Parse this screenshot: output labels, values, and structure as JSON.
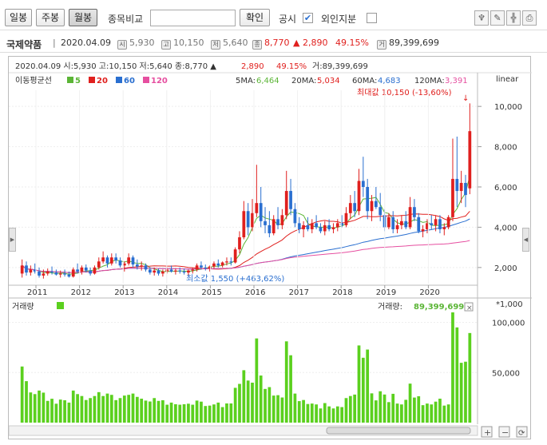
{
  "toolbar": {
    "daily": "일봉",
    "weekly": "주봉",
    "monthly": "월봉",
    "compare_label": "종목비교",
    "confirm": "확인",
    "disclosure": "공시",
    "foreign": "외인지분",
    "disclosure_checked": "✔"
  },
  "info": {
    "name": "국제약품",
    "date": "2020.04.09",
    "open": "5,930",
    "high": "10,150",
    "low": "5,640",
    "close": "8,770",
    "change": "▲ 2,890",
    "pct": "49.15%",
    "volume": "89,399,699",
    "icon_open": "시",
    "icon_high": "고",
    "icon_low": "저",
    "icon_close": "종",
    "icon_vol": "거"
  },
  "chart": {
    "ohlc_line": "2020.04.09  시:5,930  고:10,150  저:5,640  종:8,770  ▲",
    "ohlc_change": "2,890",
    "ohlc_pct": "49.15%",
    "ohlc_vol": "거:89,399,699",
    "ma_label": "이동평균선",
    "ma_legend": [
      {
        "label": "5",
        "color": "#5bb536"
      },
      {
        "label": "20",
        "color": "#e0201e"
      },
      {
        "label": "60",
        "color": "#2a6fd0"
      },
      {
        "label": "120",
        "color": "#e64fa0"
      }
    ],
    "ma_values": [
      {
        "label": "5MA:",
        "value": "6,464",
        "color": "#5bb536"
      },
      {
        "label": "20MA:",
        "value": "5,034",
        "color": "#e0201e"
      },
      {
        "label": "60MA:",
        "value": "4,683",
        "color": "#2a6fd0"
      },
      {
        "label": "120MA:",
        "value": "3,391",
        "color": "#e64fa0"
      }
    ],
    "scale": "linear",
    "max_label": "최대값 10,150 (-13,60%)",
    "min_label": "최소값 1,550 (+463,62%)",
    "price_ticks": [
      "10,000",
      "8,000",
      "6,000",
      "4,000",
      "2,000"
    ],
    "year_ticks": [
      "2011",
      "2012",
      "2013",
      "2014",
      "2015",
      "2016",
      "2017",
      "2018",
      "2019",
      "2020"
    ],
    "volume_label": "거래량",
    "volume_value_label": "거래량:",
    "volume_value": "89,399,699",
    "volume_unit": "*1,000",
    "volume_ticks": [
      "100,000",
      "50,000"
    ],
    "colors": {
      "up": "#e0201e",
      "down": "#2a6fd0",
      "volume": "#5bd01e"
    }
  },
  "chart_data": {
    "type": "candlestick",
    "title": "국제약품",
    "y_range": [
      1200,
      10800
    ],
    "series_volume_max": 110000,
    "candles": [
      [
        1700,
        2400,
        1500,
        2100
      ],
      [
        2100,
        2300,
        1600,
        1750
      ],
      [
        1750,
        2100,
        1600,
        1900
      ],
      [
        1900,
        2200,
        1700,
        1800
      ],
      [
        1800,
        2000,
        1500,
        1600
      ],
      [
        1600,
        1900,
        1450,
        1700
      ],
      [
        1700,
        1950,
        1600,
        1800
      ],
      [
        1800,
        2050,
        1650,
        1750
      ],
      [
        1750,
        1900,
        1600,
        1650
      ],
      [
        1650,
        1850,
        1500,
        1700
      ],
      [
        1700,
        1900,
        1550,
        1650
      ],
      [
        1650,
        1800,
        1500,
        1550
      ],
      [
        1550,
        2000,
        1500,
        1900
      ],
      [
        1900,
        2200,
        1700,
        1800
      ],
      [
        1800,
        2100,
        1650,
        2000
      ],
      [
        2000,
        2150,
        1750,
        1850
      ],
      [
        1850,
        2000,
        1600,
        1700
      ],
      [
        1700,
        2100,
        1650,
        2000
      ],
      [
        2000,
        2500,
        1900,
        2300
      ],
      [
        2300,
        2800,
        2200,
        2500
      ],
      [
        2500,
        2600,
        2000,
        2200
      ],
      [
        2200,
        2700,
        2100,
        2500
      ],
      [
        2500,
        2700,
        2200,
        2350
      ],
      [
        2350,
        2500,
        2000,
        2100
      ],
      [
        2100,
        2300,
        1800,
        2200
      ],
      [
        2200,
        2700,
        2100,
        2500
      ],
      [
        2500,
        2600,
        2000,
        2150
      ],
      [
        2150,
        2400,
        1900,
        2050
      ],
      [
        2050,
        2300,
        1850,
        2100
      ],
      [
        2100,
        2200,
        1800,
        1900
      ],
      [
        1900,
        2000,
        1650,
        1750
      ],
      [
        1750,
        2000,
        1600,
        1850
      ],
      [
        1850,
        1950,
        1600,
        1700
      ],
      [
        1700,
        1900,
        1550,
        1800
      ],
      [
        1800,
        2000,
        1700,
        1900
      ],
      [
        1900,
        2100,
        1750,
        1800
      ],
      [
        1800,
        1950,
        1650,
        1850
      ],
      [
        1850,
        2000,
        1700,
        1800
      ],
      [
        1800,
        1950,
        1650,
        1750
      ],
      [
        1750,
        1900,
        1600,
        1850
      ],
      [
        1850,
        2000,
        1700,
        1900
      ],
      [
        1900,
        2200,
        1800,
        2100
      ],
      [
        2100,
        2300,
        1900,
        2000
      ],
      [
        2000,
        2150,
        1850,
        1950
      ],
      [
        1950,
        2100,
        1800,
        2050
      ],
      [
        2050,
        2300,
        1950,
        2200
      ],
      [
        2200,
        2400,
        2000,
        2100
      ],
      [
        2100,
        2300,
        2000,
        2250
      ],
      [
        2250,
        2500,
        2100,
        2300
      ],
      [
        2300,
        2500,
        2100,
        2250
      ],
      [
        2250,
        3000,
        2200,
        2900
      ],
      [
        2900,
        3800,
        2700,
        3500
      ],
      [
        3500,
        5300,
        3400,
        4800
      ],
      [
        4800,
        5200,
        3600,
        4000
      ],
      [
        4000,
        5400,
        3800,
        4700
      ],
      [
        4700,
        7100,
        4500,
        5200
      ],
      [
        5200,
        6000,
        4000,
        4300
      ],
      [
        4300,
        5000,
        3700,
        4100
      ],
      [
        4100,
        4800,
        3500,
        3700
      ],
      [
        3700,
        4600,
        3600,
        4400
      ],
      [
        4400,
        5000,
        3900,
        4100
      ],
      [
        4100,
        4900,
        3900,
        4600
      ],
      [
        4600,
        6800,
        4400,
        5800
      ],
      [
        5800,
        6400,
        4600,
        4900
      ],
      [
        4900,
        5200,
        4000,
        4200
      ],
      [
        4200,
        4500,
        3700,
        3900
      ],
      [
        3900,
        4300,
        3500,
        4100
      ],
      [
        4100,
        4500,
        3800,
        3900
      ],
      [
        3900,
        4400,
        3700,
        4200
      ],
      [
        4200,
        4600,
        3900,
        4000
      ],
      [
        4000,
        4200,
        3700,
        3800
      ],
      [
        3800,
        4300,
        3600,
        4100
      ],
      [
        4100,
        4400,
        3800,
        3900
      ],
      [
        3900,
        4200,
        3700,
        4000
      ],
      [
        4000,
        4400,
        3800,
        4200
      ],
      [
        4200,
        4600,
        4000,
        4100
      ],
      [
        4100,
        5000,
        4000,
        4700
      ],
      [
        4700,
        5600,
        4400,
        5200
      ],
      [
        5200,
        5800,
        4500,
        4800
      ],
      [
        4800,
        6900,
        4600,
        6300
      ],
      [
        6300,
        7500,
        5500,
        6000
      ],
      [
        6000,
        6400,
        4400,
        4800
      ],
      [
        4800,
        5600,
        4300,
        5300
      ],
      [
        5300,
        6000,
        4900,
        5000
      ],
      [
        5000,
        5700,
        4300,
        4600
      ],
      [
        4600,
        4900,
        3800,
        4000
      ],
      [
        4000,
        4700,
        3900,
        4500
      ],
      [
        4500,
        4800,
        3700,
        3900
      ],
      [
        3900,
        4400,
        3700,
        4100
      ],
      [
        4100,
        4600,
        3900,
        4300
      ],
      [
        4300,
        4800,
        3900,
        4000
      ],
      [
        4000,
        5500,
        3900,
        5000
      ],
      [
        5000,
        5400,
        4300,
        4500
      ],
      [
        4500,
        4700,
        3700,
        3800
      ],
      [
        3800,
        4100,
        3500,
        3900
      ],
      [
        3900,
        4400,
        3700,
        4200
      ],
      [
        4200,
        4600,
        3900,
        4100
      ],
      [
        4100,
        4600,
        3800,
        4400
      ],
      [
        4400,
        4600,
        3700,
        3900
      ],
      [
        3900,
        4200,
        3600,
        4000
      ],
      [
        4000,
        4600,
        3900,
        4500
      ],
      [
        4500,
        8400,
        4300,
        6400
      ],
      [
        6400,
        8500,
        5000,
        5800
      ],
      [
        5800,
        6800,
        5200,
        6200
      ],
      [
        6200,
        6600,
        5000,
        5600
      ],
      [
        5930,
        10150,
        5640,
        8770
      ]
    ]
  }
}
